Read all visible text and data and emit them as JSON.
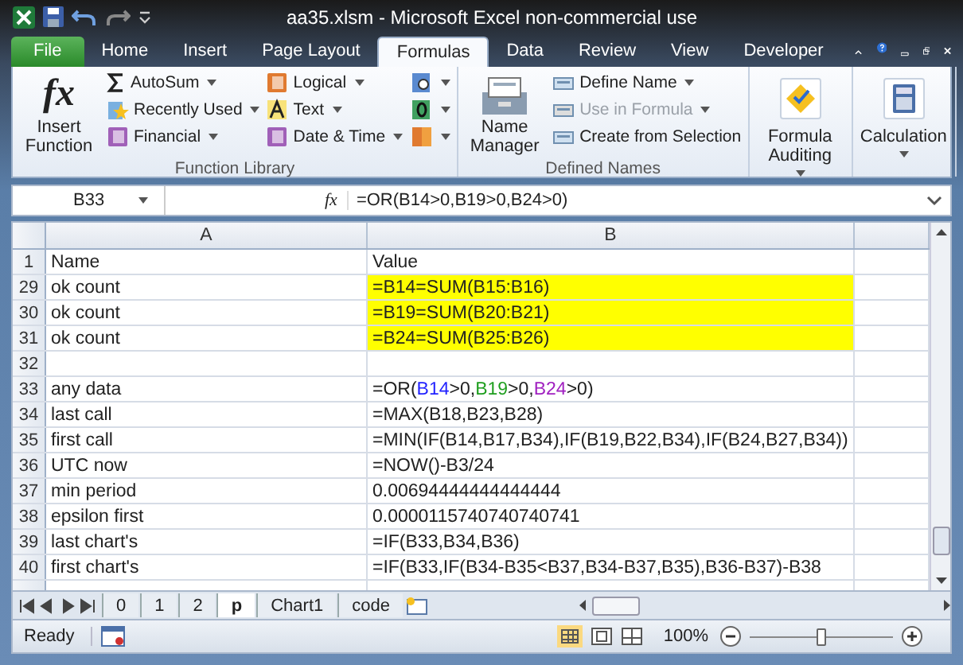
{
  "window": {
    "title": "aa35.xlsm  -  Microsoft Excel non-commercial use"
  },
  "tabs": [
    {
      "label": "File",
      "kind": "file",
      "selected": false
    },
    {
      "label": "Home",
      "kind": "tab",
      "selected": false
    },
    {
      "label": "Insert",
      "kind": "tab",
      "selected": false
    },
    {
      "label": "Page Layout",
      "kind": "tab",
      "selected": false
    },
    {
      "label": "Formulas",
      "kind": "tab",
      "selected": true
    },
    {
      "label": "Data",
      "kind": "tab",
      "selected": false
    },
    {
      "label": "Review",
      "kind": "tab",
      "selected": false
    },
    {
      "label": "View",
      "kind": "tab",
      "selected": false
    },
    {
      "label": "Developer",
      "kind": "tab",
      "selected": false
    }
  ],
  "ribbon": {
    "function_library": {
      "label": "Function Library",
      "insert_function": "Insert Function",
      "insert_function_glyph": "fx",
      "items": [
        {
          "label": "AutoSum",
          "kind": "sigma"
        },
        {
          "label": "Recently Used",
          "kind": "star"
        },
        {
          "label": "Financial",
          "kind": "book"
        },
        {
          "label": "Logical",
          "kind": "book"
        },
        {
          "label": "Text",
          "kind": "letter"
        },
        {
          "label": "Date & Time",
          "kind": "book"
        }
      ]
    },
    "defined_names": {
      "label": "Defined Names",
      "name_manager": "Name Manager",
      "items": [
        {
          "label": "Define Name",
          "disabled": false
        },
        {
          "label": "Use in Formula",
          "disabled": true
        },
        {
          "label": "Create from Selection",
          "disabled": false
        }
      ]
    },
    "formula_auditing": "Formula Auditing",
    "calculation": "Calculation"
  },
  "formula_bar": {
    "name_box": "B33",
    "fx_glyph": "fx",
    "formula": "=OR(B14>0,B19>0,B24>0)"
  },
  "columns": [
    "A",
    "B"
  ],
  "rows": [
    {
      "num": "1",
      "name": "Name",
      "value": [
        {
          "text": "Value"
        }
      ],
      "highlighted": false
    },
    {
      "num": "29",
      "name": "ok count",
      "value": [
        {
          "text": "=B14=SUM(B15:B16)"
        }
      ],
      "highlighted": true
    },
    {
      "num": "30",
      "name": "ok count",
      "value": [
        {
          "text": "=B19=SUM(B20:B21)"
        }
      ],
      "highlighted": true
    },
    {
      "num": "31",
      "name": "ok count",
      "value": [
        {
          "text": "=B24=SUM(B25:B26)"
        }
      ],
      "highlighted": true
    },
    {
      "num": "32",
      "name": "",
      "value": [],
      "highlighted": false
    },
    {
      "num": "33",
      "name": "any data",
      "value": [
        {
          "text": "=OR("
        },
        {
          "text": "B14",
          "color": "#1f1fff"
        },
        {
          "text": ">0,"
        },
        {
          "text": "B19",
          "color": "#1e9e1e"
        },
        {
          "text": ">0,"
        },
        {
          "text": "B24",
          "color": "#a020c0"
        },
        {
          "text": ">0)"
        }
      ],
      "highlighted": false
    },
    {
      "num": "34",
      "name": "last call",
      "value": [
        {
          "text": "=MAX(B18,B23,B28)"
        }
      ],
      "highlighted": false
    },
    {
      "num": "35",
      "name": "first call",
      "value": [
        {
          "text": "=MIN(IF(B14,B17,B34),IF(B19,B22,B34),IF(B24,B27,B34))"
        }
      ],
      "highlighted": false
    },
    {
      "num": "36",
      "name": "UTC now",
      "value": [
        {
          "text": "=NOW()-B3/24"
        }
      ],
      "highlighted": false
    },
    {
      "num": "37",
      "name": "min period",
      "value": [
        {
          "text": "0.00694444444444444"
        }
      ],
      "highlighted": false
    },
    {
      "num": "38",
      "name": "epsilon first",
      "value": [
        {
          "text": "0.0000115740740740741"
        }
      ],
      "highlighted": false
    },
    {
      "num": "39",
      "name": "last chart's",
      "value": [
        {
          "text": "=IF(B33,B34,B36)"
        }
      ],
      "highlighted": false
    },
    {
      "num": "40",
      "name": "first chart's",
      "value": [
        {
          "text": "=IF(B33,IF(B34-B35<B37,B34-B37,B35),B36-B37)-B38"
        }
      ],
      "highlighted": false
    }
  ],
  "sheet_tabs": [
    {
      "label": "0",
      "selected": false
    },
    {
      "label": "1",
      "selected": false
    },
    {
      "label": "2",
      "selected": false
    },
    {
      "label": "p",
      "selected": true
    },
    {
      "label": "Chart1",
      "selected": false
    },
    {
      "label": "code",
      "selected": false
    }
  ],
  "status_bar": {
    "status": "Ready",
    "zoom": "100%",
    "level": 0.5
  }
}
